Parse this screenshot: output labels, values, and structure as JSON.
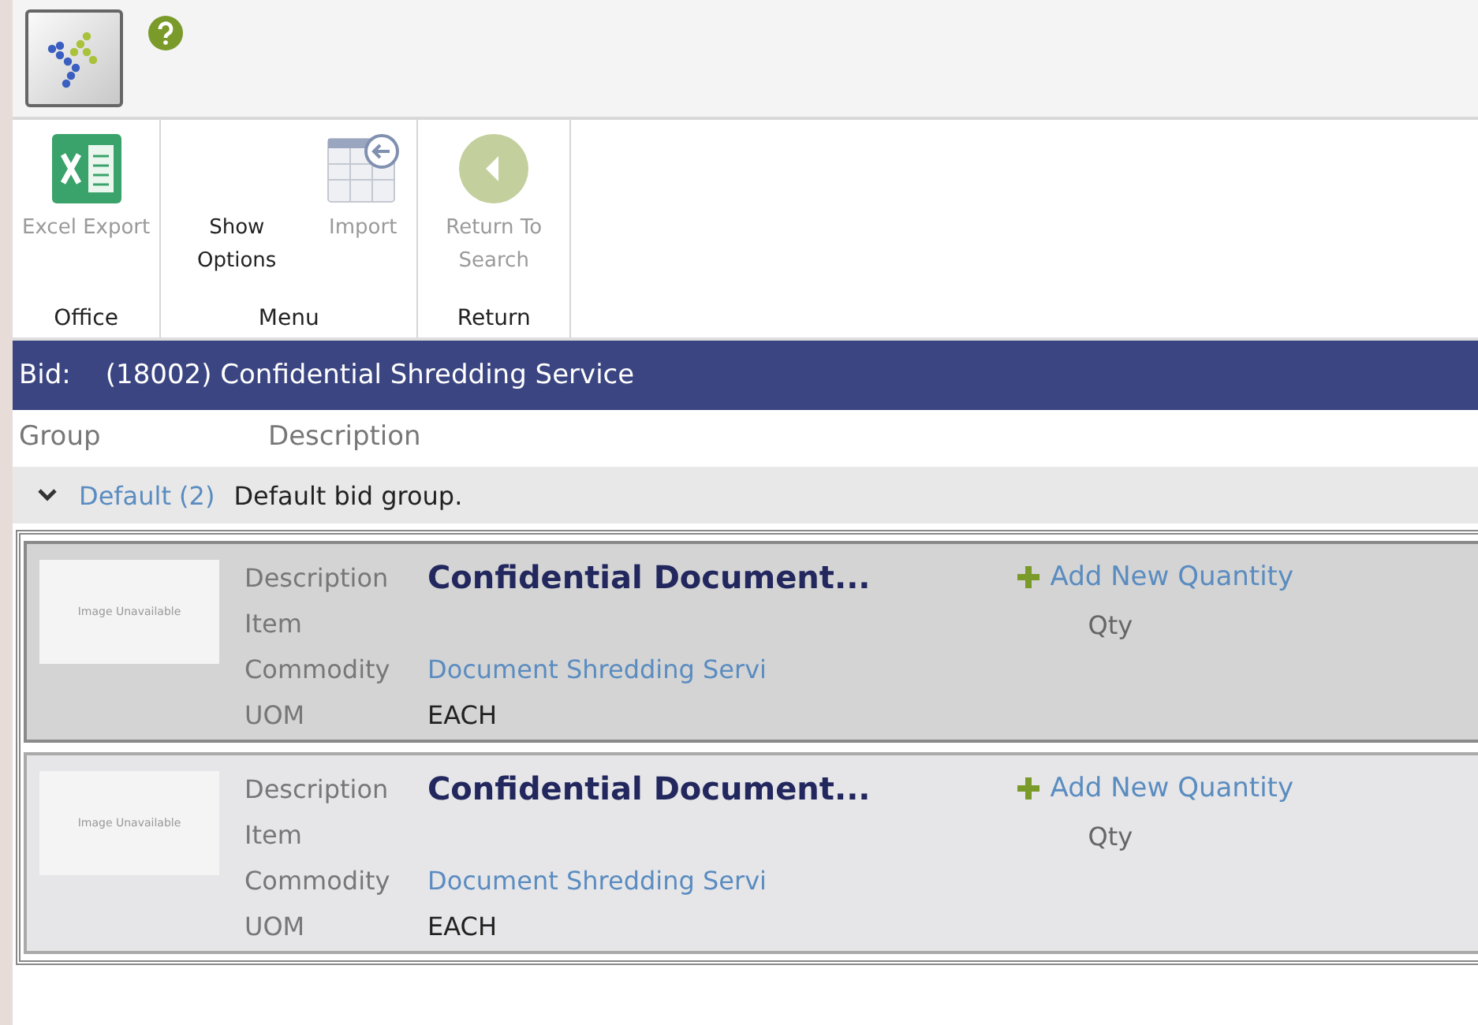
{
  "ribbon": {
    "groups": [
      {
        "label": "Office",
        "buttons": [
          {
            "label": "Excel Export",
            "kind": "excel",
            "disabled": true
          }
        ]
      },
      {
        "label": "Menu",
        "buttons": [
          {
            "label": "Show Options",
            "kind": "text",
            "disabled": false
          },
          {
            "label": "Import",
            "kind": "import",
            "disabled": true
          }
        ]
      },
      {
        "label": "Return",
        "buttons": [
          {
            "label": "Return To Search",
            "kind": "back",
            "disabled": true
          }
        ]
      }
    ]
  },
  "bid": {
    "label": "Bid:",
    "title": "(18002) Confidential Shredding Service"
  },
  "columns": [
    "Group",
    "Description"
  ],
  "group": {
    "name": "Default (2)",
    "description": "Default bid group.",
    "expanded": true
  },
  "items": [
    {
      "selected": true,
      "image_text": "Image Unavailable",
      "fields": [
        {
          "label": "Description",
          "value": "Confidential Document...",
          "kind": "title"
        },
        {
          "label": "Item"
        },
        {
          "label": "Commodity",
          "value": "Document Shredding Servi",
          "kind": "link"
        },
        {
          "label": "UOM",
          "value": "EACH",
          "kind": "plain"
        }
      ],
      "add_label": "Add New Quantity",
      "qty_label": "Qty"
    },
    {
      "selected": false,
      "image_text": "Image Unavailable",
      "fields": [
        {
          "label": "Description",
          "value": "Confidential Document...",
          "kind": "title"
        },
        {
          "label": "Item"
        },
        {
          "label": "Commodity",
          "value": "Document Shredding Servi",
          "kind": "link"
        },
        {
          "label": "UOM",
          "value": "EACH",
          "kind": "plain"
        }
      ],
      "add_label": "Add New Quantity",
      "qty_label": "Qty"
    }
  ]
}
